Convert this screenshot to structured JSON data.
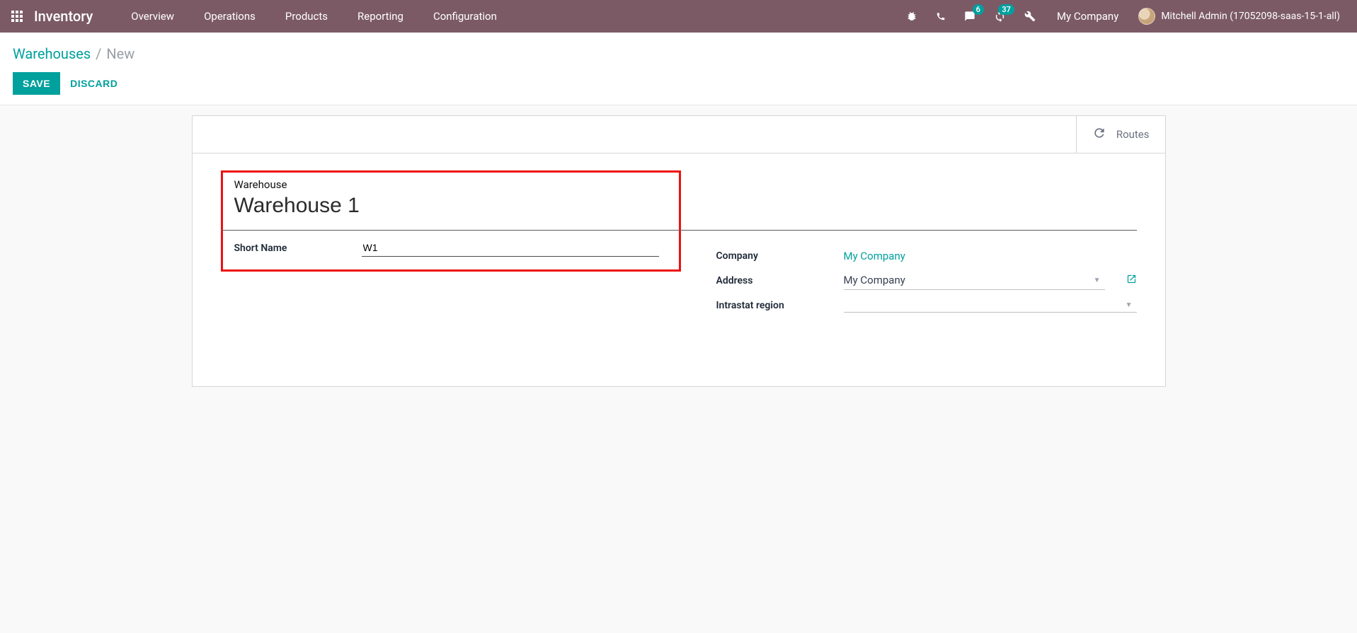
{
  "navbar": {
    "brand": "Inventory",
    "menu": [
      "Overview",
      "Operations",
      "Products",
      "Reporting",
      "Configuration"
    ],
    "chat_badge": "6",
    "timer_badge": "37",
    "company": "My Company",
    "user": "Mitchell Admin (17052098-saas-15-1-all)"
  },
  "breadcrumb": {
    "parent": "Warehouses",
    "current": "New"
  },
  "buttons": {
    "save": "SAVE",
    "discard": "DISCARD"
  },
  "stat": {
    "routes": "Routes"
  },
  "form": {
    "name_label": "Warehouse",
    "name_value": "Warehouse 1",
    "short_name_label": "Short Name",
    "short_name_value": "W1",
    "company_label": "Company",
    "company_value": "My Company",
    "address_label": "Address",
    "address_value": "My Company",
    "intrastat_label": "Intrastat region",
    "intrastat_value": ""
  }
}
